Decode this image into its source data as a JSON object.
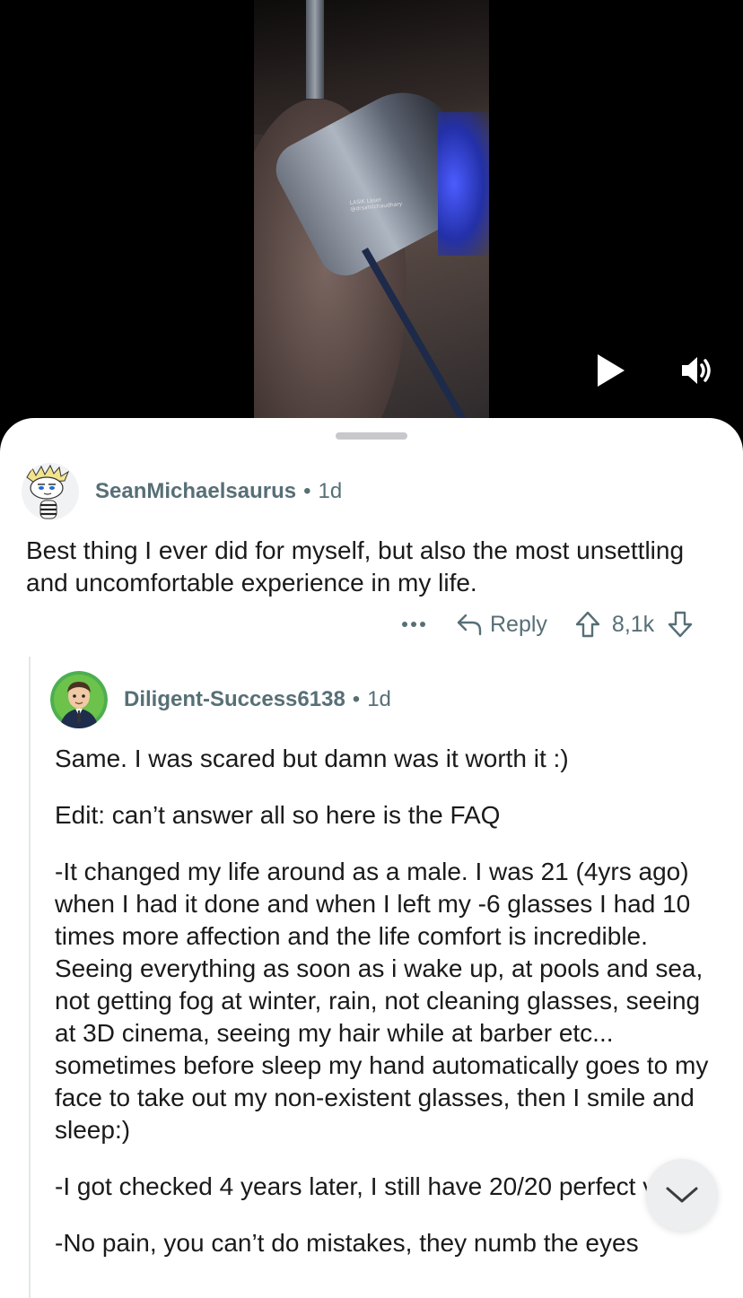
{
  "video": {
    "watermark_line1": "LASIK Laser",
    "watermark_line2": "@drsahilchaudhary",
    "play_icon": "play-icon",
    "sound_icon": "speaker-icon"
  },
  "comments": [
    {
      "username": "SeanMichaelsaurus",
      "separator": "•",
      "age": "1d",
      "body": "Best thing I ever did for myself, but also the most unsettling and uncomfortable experience in my life.",
      "actions": {
        "more_icon": "more-icon",
        "reply_label": "Reply",
        "score": "8,1k"
      }
    },
    {
      "username": "Diligent-Success6138",
      "separator": "•",
      "age": "1d",
      "paragraphs": [
        "Same. I was scared but damn was it worth it :)",
        "Edit: can’t answer all so here is the FAQ",
        "-It changed my life around as a male. I was 21 (4yrs ago) when I had it done and when I left my -6 glasses I had 10 times more affection and the life comfort is incredible. Seeing everything as soon as i wake up, at pools and sea, not getting fog at winter, rain, not cleaning glasses, seeing at 3D cinema, seeing my hair while at barber etc... sometimes before sleep my hand automatically goes to my face to take out my non-existent glasses, then I smile and sleep:)",
        "-I got checked 4 years later, I still have 20/20 perfect vision.",
        "-No pain, you can’t do mistakes, they numb the eyes"
      ]
    }
  ],
  "colors": {
    "meta_text": "#576f76",
    "body_text": "#1a1a1b",
    "sheet_bg": "#ffffff",
    "video_bg": "#000000"
  }
}
